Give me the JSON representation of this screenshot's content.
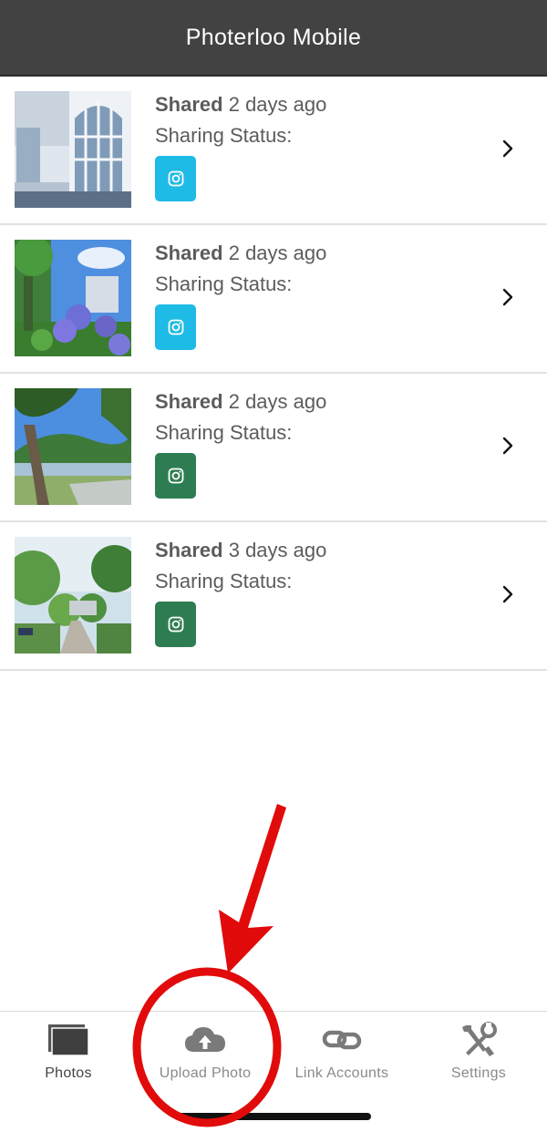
{
  "header": {
    "title": "Photerloo Mobile"
  },
  "photos": [
    {
      "shared_label": "Shared",
      "time": "2 days ago",
      "status_label": "Sharing Status:",
      "badge_color": "#1ebbe6",
      "icon": "instagram-icon",
      "chevron": "chevron-right-icon"
    },
    {
      "shared_label": "Shared",
      "time": "2 days ago",
      "status_label": "Sharing Status:",
      "badge_color": "#1ebbe6",
      "icon": "instagram-icon",
      "chevron": "chevron-right-icon"
    },
    {
      "shared_label": "Shared",
      "time": "2 days ago",
      "status_label": "Sharing Status:",
      "badge_color": "#2e7d52",
      "icon": "instagram-icon",
      "chevron": "chevron-right-icon"
    },
    {
      "shared_label": "Shared",
      "time": "3 days ago",
      "status_label": "Sharing Status:",
      "badge_color": "#2e7d52",
      "icon": "instagram-icon",
      "chevron": "chevron-right-icon"
    }
  ],
  "tabbar": {
    "tabs": [
      {
        "label": "Photos",
        "icon": "photos-icon",
        "active": true
      },
      {
        "label": "Upload Photo",
        "icon": "cloud-upload-icon",
        "active": false
      },
      {
        "label": "Link Accounts",
        "icon": "link-icon",
        "active": false
      },
      {
        "label": "Settings",
        "icon": "tools-icon",
        "active": false
      }
    ]
  },
  "colors": {
    "header_bg": "#424242",
    "annotation_red": "#e10b0b",
    "badge_blue": "#1ebbe6",
    "badge_green": "#2e7d52"
  }
}
